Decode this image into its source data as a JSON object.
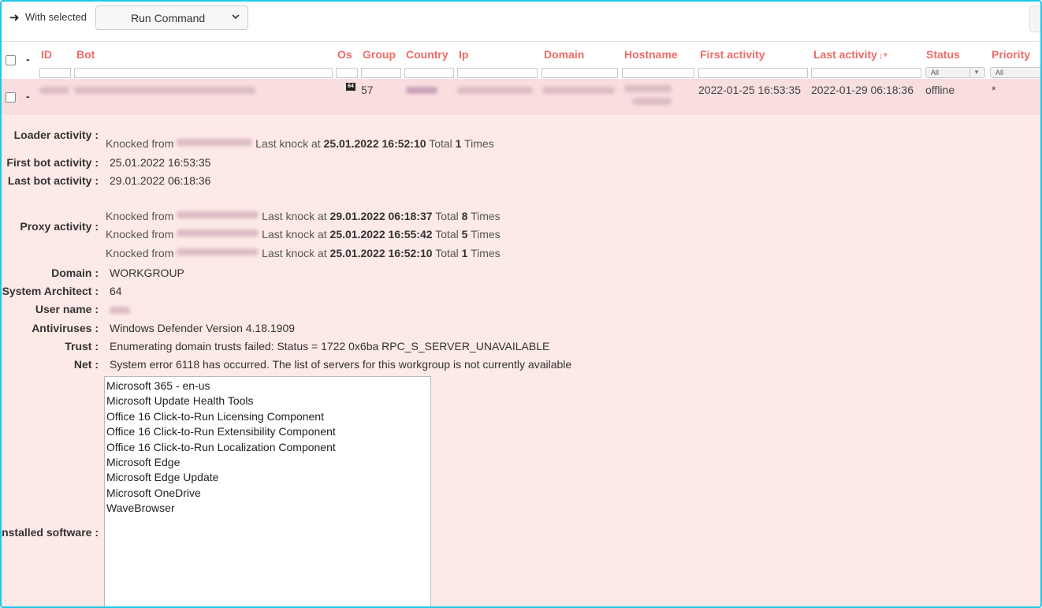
{
  "toolbar": {
    "with_selected_label": "With selected",
    "command_select_value": "Run Command"
  },
  "columns": {
    "dash": "-",
    "id": "ID",
    "bot": "Bot",
    "os": "Os",
    "group": "Group",
    "country": "Country",
    "ip": "Ip",
    "domain": "Domain",
    "hostname": "Hostname",
    "first_activity": "First activity",
    "last_activity": "Last activity",
    "status": "Status",
    "priority": "Priority"
  },
  "filters": {
    "status_value": "All",
    "priority_value": "All"
  },
  "row": {
    "dash": "-",
    "os_badge": "64",
    "group": "57",
    "first_activity": "2022-01-25 16:53:35",
    "last_activity": "2022-01-29 06:18:36",
    "status": "offline",
    "priority": "*"
  },
  "details": {
    "loader_label": "Loader activity :",
    "loader": {
      "knocked_from": "Knocked from",
      "last_knock_at": "Last knock at",
      "time": "25.01.2022 16:52:10",
      "total": "Total",
      "count": "1",
      "times": "Times"
    },
    "first_bot_label": "First bot activity :",
    "first_bot_value": "25.01.2022 16:53:35",
    "last_bot_label": "Last bot activity :",
    "last_bot_value": "29.01.2022 06:18:36",
    "proxy_label": "Proxy activity :",
    "proxy": [
      {
        "knocked_from": "Knocked from",
        "last_knock_at": "Last knock at",
        "time": "29.01.2022 06:18:37",
        "total": "Total",
        "count": "8",
        "times": "Times"
      },
      {
        "knocked_from": "Knocked from",
        "last_knock_at": "Last knock at",
        "time": "25.01.2022 16:55:42",
        "total": "Total",
        "count": "5",
        "times": "Times"
      },
      {
        "knocked_from": "Knocked from",
        "last_knock_at": "Last knock at",
        "time": "25.01.2022 16:52:10",
        "total": "Total",
        "count": "1",
        "times": "Times"
      }
    ],
    "domain_label": "Domain :",
    "domain_value": "WORKGROUP",
    "arch_label": "System Architect :",
    "arch_value": "64",
    "user_label": "User name :",
    "av_label": "Antiviruses :",
    "av_value": "Windows Defender Version   4.18.1909",
    "trust_label": "Trust :",
    "trust_value": "Enumerating domain trusts failed: Status = 1722 0x6ba RPC_S_SERVER_UNAVAILABLE",
    "net_label": "Net :",
    "net_value": "System error 6118 has occurred. The list of servers for this workgroup is not currently available",
    "software_label": "Installed software :",
    "software": [
      " Microsoft 365 - en-us",
      "Microsoft Update Health Tools",
      "Office 16 Click-to-Run Licensing Component",
      "Office 16 Click-to-Run Extensibility Component",
      "Office 16 Click-to-Run Localization Component",
      "Microsoft Edge",
      "Microsoft Edge Update",
      "Microsoft OneDrive",
      "WaveBrowser"
    ]
  },
  "colors": {
    "accent": "#ee6b68",
    "row_bg": "#f8dede",
    "details_bg": "#fde9e6",
    "frame": "#1ec8e6"
  }
}
